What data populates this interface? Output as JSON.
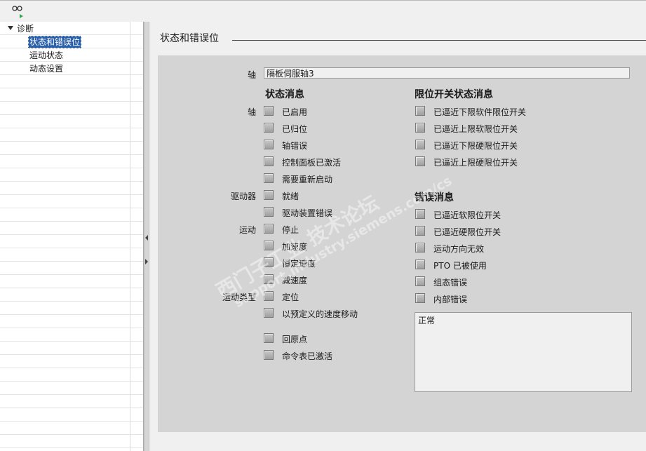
{
  "sidebar": {
    "root": "诊断",
    "items": [
      "状态和错误位",
      "运动状态",
      "动态设置"
    ]
  },
  "section_title": "状态和错误位",
  "axis": {
    "label": "轴",
    "value": "隔板伺服轴3"
  },
  "status_messages": {
    "heading": "状态消息",
    "groups": [
      "轴",
      "驱动器",
      "运动",
      "运动类型"
    ],
    "items": [
      "已启用",
      "已归位",
      "轴错误",
      "控制面板已激活",
      "需要重新启动",
      "就绪",
      "驱动装置错误",
      "停止",
      "加速度",
      "恒定速度",
      "减速度",
      "定位",
      "以预定义的速度移动",
      "回原点",
      "命令表已激活"
    ]
  },
  "limit_switch": {
    "heading": "限位开关状态消息",
    "items": [
      "已逼近下限软件限位开关",
      "已逼近上限软限位开关",
      "已逼近下限硬限位开关",
      "已逼近上限硬限位开关"
    ]
  },
  "error_messages": {
    "heading": "错误消息",
    "items": [
      "已逼近软限位开关",
      "已逼近硬限位开关",
      "运动方向无效",
      "PTO 已被使用",
      "组态错误",
      "内部错误"
    ]
  },
  "message_box": {
    "text": "正常"
  },
  "watermark": {
    "line1": "西门子工业 技术论坛",
    "line2": "support.industry.siemens.com/cs"
  },
  "colors": {
    "selection": "#2a5fab",
    "panel": "#d4d4d4"
  }
}
